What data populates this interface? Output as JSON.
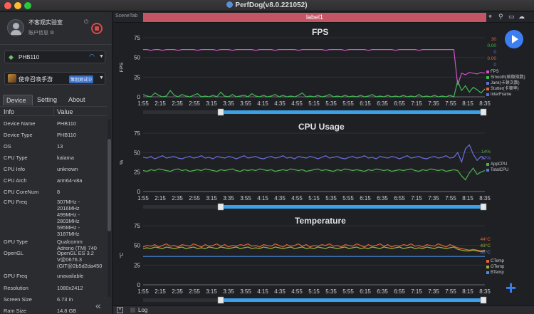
{
  "window": {
    "title": "PerfDog(v8.0.221052)"
  },
  "user": {
    "name": "不客观实验室",
    "info_label": "账户信息"
  },
  "device_selector": {
    "label": "PHB110"
  },
  "app_selector": {
    "label": "使命召唤手游",
    "tag": "策划测试中"
  },
  "tabs": [
    {
      "label": "Device",
      "active": true
    },
    {
      "label": "Setting",
      "active": false
    },
    {
      "label": "About",
      "active": false
    }
  ],
  "table": {
    "headers": [
      "Info",
      "Value"
    ],
    "rows": [
      {
        "key": "Device Name",
        "value": "PHB110"
      },
      {
        "key": "Device Type",
        "value": "PHB110"
      },
      {
        "key": "OS",
        "value": "13"
      },
      {
        "key": "CPU Type",
        "value": "kalama"
      },
      {
        "key": "CPU Info",
        "value": "unknown"
      },
      {
        "key": "CPU Arch",
        "value": "arm64-v8a"
      },
      {
        "key": "CPU CoreNum",
        "value": "8"
      },
      {
        "key": "CPU Freq",
        "value": "307MHz -\n2016MHz\n499MHz -\n2803MHz\n595MHz -\n3187MHz"
      },
      {
        "key": "GPU Type",
        "value": "Qualcomm\nAdreno (TM) 740"
      },
      {
        "key": "OpenGL",
        "value": "OpenGL ES 3.2\nV@0676.3\n(GIT@2b5d2da450"
      },
      {
        "key": "GPU Freq",
        "value": "unavailable"
      },
      {
        "key": "Resolution",
        "value": "1080x2412"
      },
      {
        "key": "Screen Size",
        "value": "6.73 in"
      },
      {
        "key": "Ram Size",
        "value": "14.8 GB"
      }
    ]
  },
  "scene_tab": {
    "label": "SceneTab",
    "label_bar": "label1"
  },
  "log": {
    "label": "Log"
  },
  "colors": {
    "fps": "#d054c8",
    "smooth": "#3fb950",
    "jank": "#5a73d8",
    "stutter": "#e0663a",
    "app_cpu": "#4fb04a",
    "total_cpu": "#6b6fe0",
    "ctemp": "#e0643c",
    "gtemp": "#9ab33a",
    "btemp": "#4a8fe0",
    "accent": "#3d7ef0",
    "label_bar": "#c45565"
  },
  "chart_data": [
    {
      "type": "line",
      "title": "FPS",
      "ylabel": "FPS",
      "ylim": [
        0,
        75
      ],
      "yticks": [
        0,
        25,
        50,
        75
      ],
      "xtick_labels": [
        "1:55",
        "2:15",
        "2:35",
        "2:55",
        "3:15",
        "3:35",
        "3:55",
        "4:15",
        "4:35",
        "4:55",
        "5:15",
        "5:35",
        "5:55",
        "6:15",
        "6:35",
        "6:55",
        "7:15",
        "7:35",
        "7:55",
        "8:15",
        "8:35"
      ],
      "current_values": [
        "30",
        "0.00",
        "0",
        "0.00",
        "0"
      ],
      "series": [
        {
          "name": "FPS",
          "color_key": "fps",
          "values": [
            60,
            60,
            59,
            60,
            60,
            59,
            60,
            60,
            60,
            59,
            60,
            60,
            60,
            60,
            59,
            60,
            60,
            60,
            60,
            59,
            60,
            60,
            60,
            59,
            60,
            60,
            60,
            60,
            60,
            59,
            60,
            60,
            60,
            60,
            59,
            60,
            60,
            60,
            60,
            60,
            59,
            60,
            60,
            60,
            60,
            60,
            60,
            59,
            60,
            60,
            60,
            60,
            59,
            60,
            60,
            60,
            60,
            60,
            59,
            60,
            60,
            60,
            60,
            60,
            60,
            59,
            60,
            60,
            60,
            60,
            60,
            59,
            60,
            60,
            60,
            60,
            60,
            60,
            60,
            60,
            60,
            15,
            30,
            28,
            31,
            30,
            29,
            31,
            30
          ]
        },
        {
          "name": "Smooth(帧稳指数)",
          "color_key": "smooth",
          "values": [
            3,
            1,
            0,
            5,
            2,
            0,
            1,
            8,
            2,
            0,
            3,
            1,
            0,
            2,
            4,
            0,
            1,
            0,
            2,
            0,
            6,
            1,
            0,
            3,
            0,
            1,
            2,
            0,
            4,
            1,
            0,
            2,
            0,
            1,
            3,
            0,
            2,
            0,
            1,
            0,
            2,
            5,
            0,
            1,
            0,
            2,
            0,
            1,
            3,
            0,
            1,
            0,
            2,
            0,
            1,
            0,
            2,
            0,
            1,
            3,
            0,
            1,
            0,
            2,
            0,
            1,
            0,
            2,
            0,
            1,
            0,
            3,
            0,
            1,
            0,
            2,
            0,
            1,
            0,
            2,
            0,
            20,
            8,
            14,
            6,
            12,
            9,
            5,
            10
          ]
        },
        {
          "name": "Jank(卡顿次数)",
          "color_key": "jank",
          "values": []
        },
        {
          "name": "Stutter(卡顿率)",
          "color_key": "stutter",
          "values": []
        },
        {
          "name": "InterFrame",
          "color_key": "interframe",
          "values": []
        }
      ]
    },
    {
      "type": "line",
      "title": "CPU Usage",
      "ylabel": "%",
      "ylim": [
        0,
        75
      ],
      "yticks": [
        0,
        25,
        50,
        75
      ],
      "xtick_labels": [
        "1:55",
        "2:15",
        "2:35",
        "2:55",
        "3:15",
        "3:35",
        "3:55",
        "4:15",
        "4:35",
        "4:55",
        "5:15",
        "5:35",
        "5:55",
        "6:15",
        "6:35",
        "6:55",
        "7:15",
        "7:35",
        "7:55",
        "8:15",
        "8:35"
      ],
      "current_values": [
        "14%",
        "27%"
      ],
      "series": [
        {
          "name": "AppCPU",
          "color_key": "app_cpu",
          "values": [
            27,
            26,
            28,
            27,
            29,
            28,
            27,
            26,
            28,
            29,
            27,
            28,
            26,
            27,
            28,
            27,
            29,
            28,
            27,
            26,
            28,
            27,
            28,
            29,
            27,
            26,
            28,
            27,
            28,
            27,
            29,
            28,
            27,
            28,
            26,
            27,
            28,
            27,
            29,
            28,
            27,
            28,
            26,
            27,
            28,
            29,
            27,
            28,
            27,
            26,
            28,
            27,
            29,
            28,
            27,
            28,
            27,
            26,
            28,
            27,
            29,
            28,
            27,
            28,
            26,
            27,
            28,
            27,
            28,
            29,
            27,
            26,
            28,
            27,
            29,
            28,
            27,
            28,
            26,
            27,
            28,
            27,
            20,
            15,
            24,
            30,
            22,
            25,
            27
          ]
        },
        {
          "name": "TotalCPU",
          "color_key": "total_cpu",
          "values": [
            44,
            43,
            45,
            42,
            44,
            46,
            43,
            44,
            45,
            43,
            42,
            44,
            45,
            43,
            44,
            46,
            43,
            44,
            42,
            45,
            44,
            43,
            45,
            44,
            42,
            44,
            46,
            43,
            44,
            45,
            43,
            42,
            44,
            45,
            43,
            44,
            46,
            43,
            44,
            42,
            45,
            44,
            43,
            45,
            44,
            42,
            44,
            46,
            43,
            44,
            45,
            43,
            42,
            44,
            45,
            43,
            44,
            46,
            43,
            44,
            42,
            45,
            44,
            43,
            45,
            44,
            42,
            44,
            46,
            43,
            44,
            45,
            43,
            42,
            44,
            45,
            43,
            44,
            46,
            43,
            44,
            50,
            38,
            55,
            60,
            48,
            40,
            45,
            42
          ]
        }
      ]
    },
    {
      "type": "line",
      "title": "Temperature",
      "ylabel": "°C",
      "ylim": [
        0,
        75
      ],
      "yticks": [
        0,
        25,
        50,
        75
      ],
      "xtick_labels": [
        "1:55",
        "2:15",
        "2:35",
        "2:55",
        "3:15",
        "3:35",
        "3:55",
        "4:15",
        "4:35",
        "4:55",
        "5:15",
        "5:35",
        "5:55",
        "6:15",
        "6:35",
        "6:55",
        "7:15",
        "7:35",
        "7:55",
        "8:15",
        "8:35"
      ],
      "current_values": [
        "44°C",
        "43°C",
        "36°C"
      ],
      "series": [
        {
          "name": "CTemp",
          "color_key": "ctemp",
          "values": [
            48,
            50,
            49,
            51,
            48,
            50,
            52,
            49,
            50,
            48,
            51,
            50,
            49,
            52,
            50,
            48,
            51,
            49,
            50,
            52,
            49,
            51,
            48,
            50,
            49,
            51,
            50,
            52,
            49,
            50,
            48,
            51,
            50,
            49,
            52,
            50,
            48,
            51,
            49,
            50,
            52,
            49,
            51,
            48,
            50,
            49,
            51,
            50,
            52,
            49,
            50,
            48,
            51,
            50,
            49,
            52,
            50,
            48,
            51,
            49,
            50,
            52,
            49,
            51,
            48,
            50,
            49,
            51,
            50,
            52,
            49,
            50,
            48,
            51,
            50,
            49,
            52,
            50,
            48,
            51,
            49,
            47,
            46,
            45,
            44,
            45,
            44,
            43,
            44
          ]
        },
        {
          "name": "GTemp",
          "color_key": "gtemp",
          "values": [
            46,
            47,
            46,
            48,
            47,
            46,
            48,
            47,
            46,
            47,
            48,
            46,
            47,
            48,
            46,
            47,
            46,
            48,
            47,
            46,
            48,
            47,
            46,
            47,
            48,
            46,
            47,
            48,
            46,
            47,
            46,
            48,
            47,
            46,
            48,
            47,
            46,
            47,
            48,
            46,
            47,
            48,
            46,
            47,
            46,
            48,
            47,
            46,
            48,
            47,
            46,
            47,
            48,
            46,
            47,
            48,
            46,
            47,
            46,
            48,
            47,
            46,
            48,
            47,
            46,
            47,
            48,
            46,
            47,
            48,
            46,
            47,
            46,
            48,
            47,
            46,
            48,
            47,
            46,
            47,
            48,
            45,
            44,
            43,
            43,
            44,
            43,
            42,
            43
          ]
        },
        {
          "name": "BTemp",
          "color_key": "btemp",
          "values": [
            36,
            36,
            36,
            36,
            36,
            36,
            36,
            36,
            36,
            36,
            36,
            36,
            36,
            36,
            36,
            36,
            36,
            36,
            36,
            36,
            36,
            36,
            36,
            36,
            36,
            36,
            36,
            36,
            36,
            36,
            36,
            36,
            36,
            36,
            36,
            36,
            36,
            36,
            36,
            36,
            36,
            36,
            36,
            36,
            36,
            36,
            36,
            36,
            36,
            36,
            36,
            36,
            36,
            36,
            36,
            36,
            36,
            36,
            36,
            36,
            36,
            36,
            36,
            36,
            36,
            36,
            36,
            36,
            36,
            36,
            36,
            36,
            36,
            36,
            36,
            36,
            36,
            36,
            36,
            36,
            36,
            36,
            36,
            36,
            36,
            36,
            36,
            36,
            36
          ]
        }
      ]
    }
  ]
}
